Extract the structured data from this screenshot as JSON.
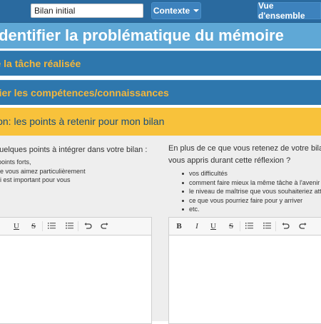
{
  "header": {
    "title_field_value": "Bilan initial",
    "context_button": "Contexte",
    "overview_button": "Vue d'ensemble"
  },
  "page": {
    "title": "Identifier la problématique du mémoire"
  },
  "steps": [
    {
      "label": "re la tâche réalisée"
    },
    {
      "label": "fier les compétences/connaissances"
    },
    {
      "label": "xion: les points à retenir pour mon bilan"
    }
  ],
  "left_column": {
    "prompt": "quelques points à intégrer dans votre bilan :",
    "hints": [
      "s points forts,",
      "que vous aimez particulièrement",
      "qui est important pour vous",
      "."
    ]
  },
  "right_column": {
    "prompt_line1": "En plus de ce que vous retenez de votre bilan, q",
    "prompt_line2": "vous appris durant cette réflexion ?",
    "hints": [
      "vos difficultés",
      "comment faire mieux la même tâche à l'avenir",
      "le niveau de maîtrise que vous souhaiteriez attei",
      "ce que vous pourriez faire pour y arriver",
      "etc."
    ]
  },
  "toolbar": {
    "bold": "B",
    "italic": "I",
    "underline": "U",
    "strike": "S"
  },
  "colors": {
    "topbar": "#2a6a9f",
    "title_band": "#5fa8d6",
    "step_band": "#2e77ad",
    "step_text": "#f5b63a",
    "active_step": "#f8c23b"
  }
}
